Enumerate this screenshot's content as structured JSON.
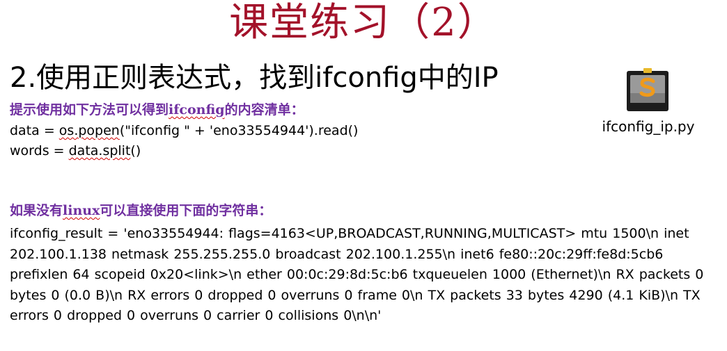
{
  "slide": {
    "title": "课堂练习（2）",
    "heading": "2.使用正则表达式，找到ifconfig中的IP",
    "hint1": {
      "prefix": "提示使用如下方法可以得到",
      "keyword": "ifconfig",
      "suffix": "的内容清单："
    },
    "code_line1": {
      "prefix": "data = ",
      "call": "os.popen",
      "suffix": "(\"ifconfig \" + 'eno33554944').read()"
    },
    "code_line2": {
      "prefix": "words = ",
      "call": "data.split",
      "suffix": "()"
    },
    "hint2": {
      "prefix": "如果没有",
      "keyword": "linux",
      "suffix": "可以直接使用下面的字符串："
    },
    "result_text": "ifconfig_result = 'eno33554944: flags=4163<UP,BROADCAST,RUNNING,MULTICAST>  mtu 1500\\n        inet 202.100.1.138  netmask 255.255.255.0  broadcast 202.100.1.255\\n        inet6 fe80::20c:29ff:fe8d:5cb6  prefixlen 64  scopeid 0x20<link>\\n        ether 00:0c:29:8d:5c:b6  txqueuelen 1000  (Ethernet)\\n        RX packets 0  bytes 0 (0.0 B)\\n        RX errors 0  dropped 0  overruns 0  frame 0\\n        TX packets 33  bytes 4290 (4.1 KiB)\\n        TX errors 0  dropped 0 overruns 0  carrier 0  collisions 0\\n\\n'",
    "file": {
      "name": "ifconfig_ip.py",
      "icon": "sublime-text-file-icon"
    }
  },
  "colors": {
    "title": "#a3122a",
    "hint": "#7030a0",
    "spellcheck": "#d00000"
  }
}
